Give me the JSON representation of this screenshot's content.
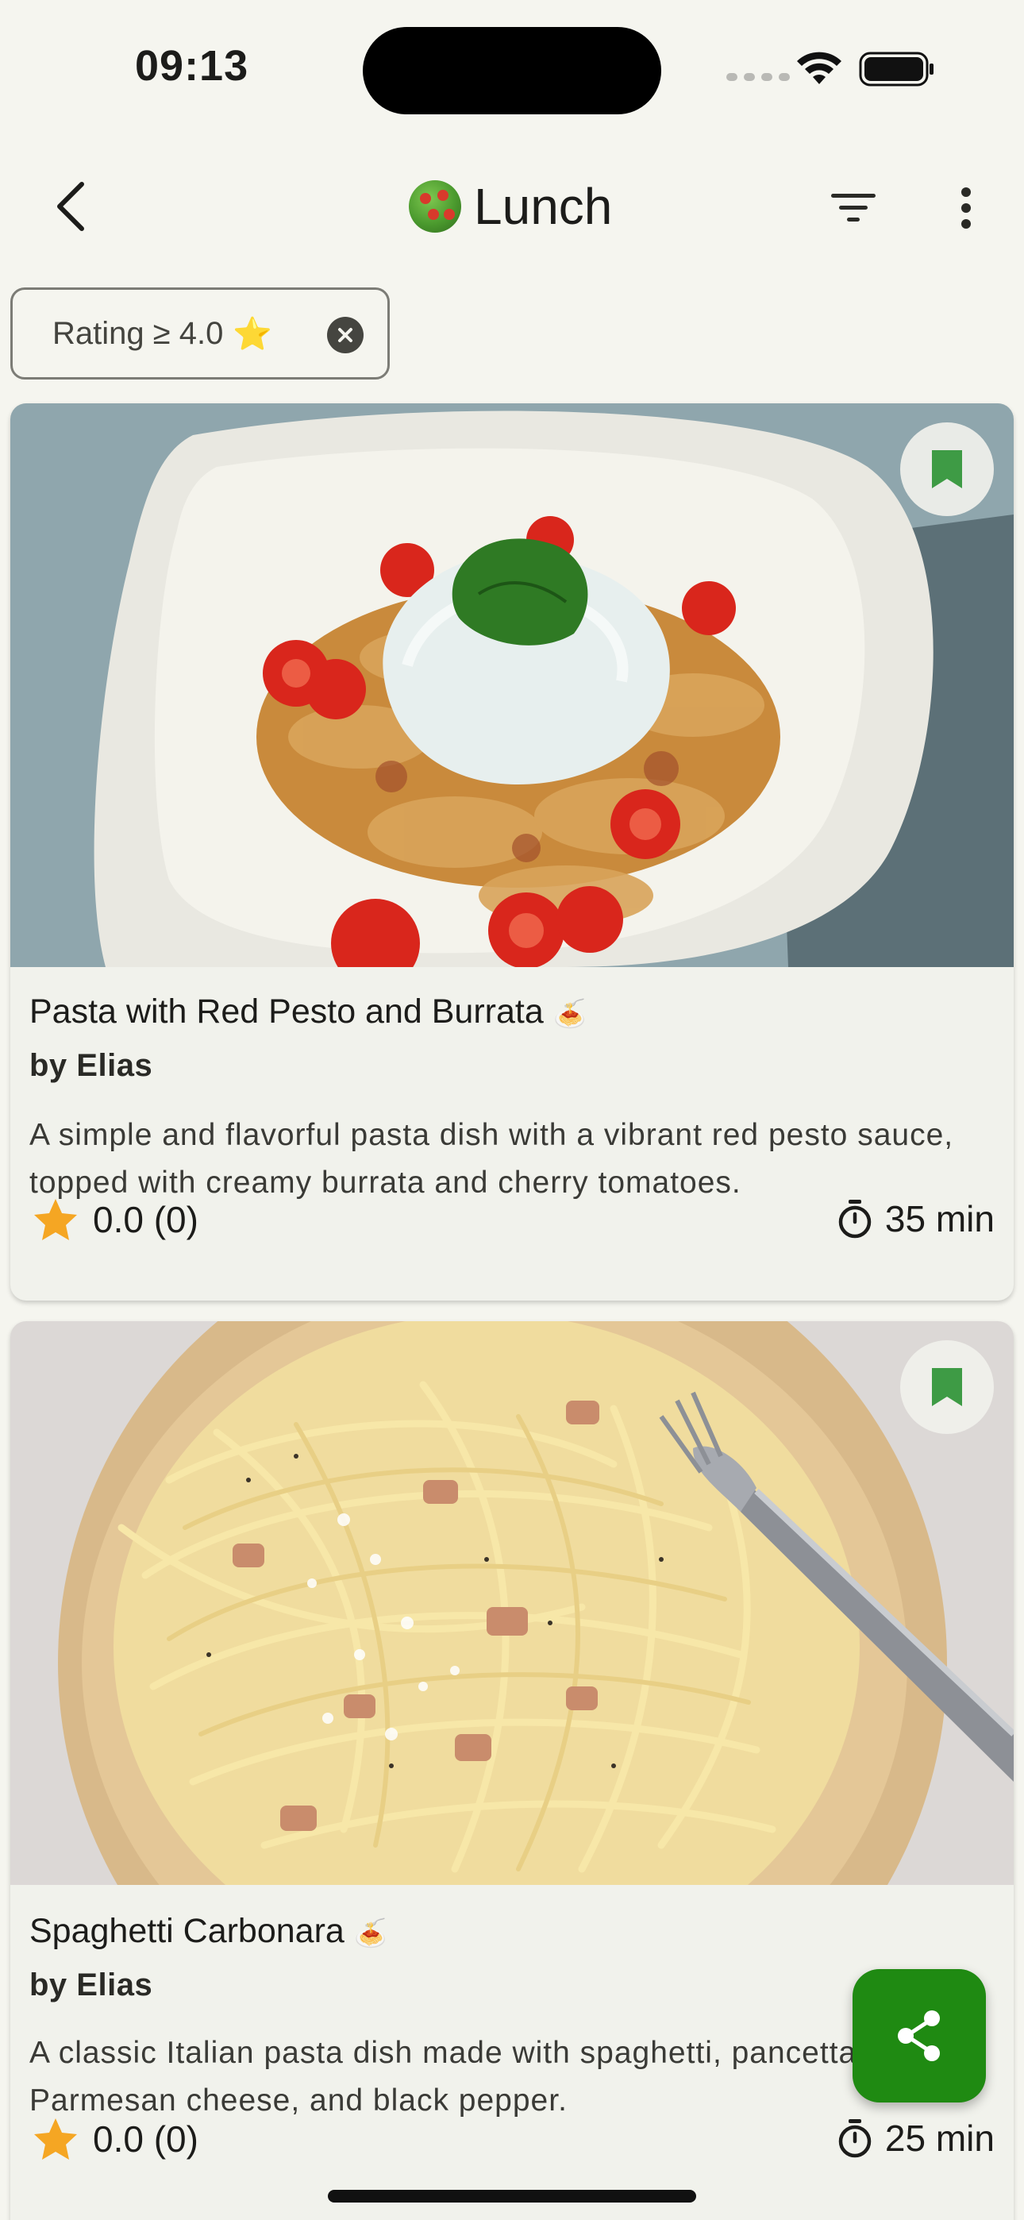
{
  "status_bar": {
    "time": "09:13"
  },
  "app_bar": {
    "title": "Lunch",
    "title_icon": "salad-emoji",
    "back_icon": "chevron-left-icon",
    "filter_icon": "filter-icon",
    "more_icon": "more-vertical-icon"
  },
  "filter_chip": {
    "label": "Rating ≥ 4.0",
    "star": "⭐",
    "close_icon": "close-circle-icon"
  },
  "recipes": [
    {
      "title": "Pasta with Red Pesto and Burrata",
      "title_emoji": "🍝",
      "author": "by Elias",
      "description": "A simple and flavorful pasta dish with a vibrant red pesto sauce, topped with creamy burrata and cherry tomatoes.",
      "rating": "0.0 (0)",
      "duration": "35 min",
      "bookmarked": true
    },
    {
      "title": "Spaghetti Carbonara",
      "title_emoji": "🍝",
      "author": "by Elias",
      "description": "A classic Italian pasta dish made with spaghetti, pancetta, eggs, Parmesan cheese, and black pepper.",
      "rating": "0.0 (0)",
      "duration": "25 min",
      "bookmarked": true
    }
  ],
  "fab": {
    "icon": "share-icon"
  },
  "colors": {
    "background": "#f5f5ef",
    "card": "#f1f2ec",
    "accent": "#1f8a12",
    "bookmark": "#3e9b45",
    "star": "#f5a623"
  }
}
